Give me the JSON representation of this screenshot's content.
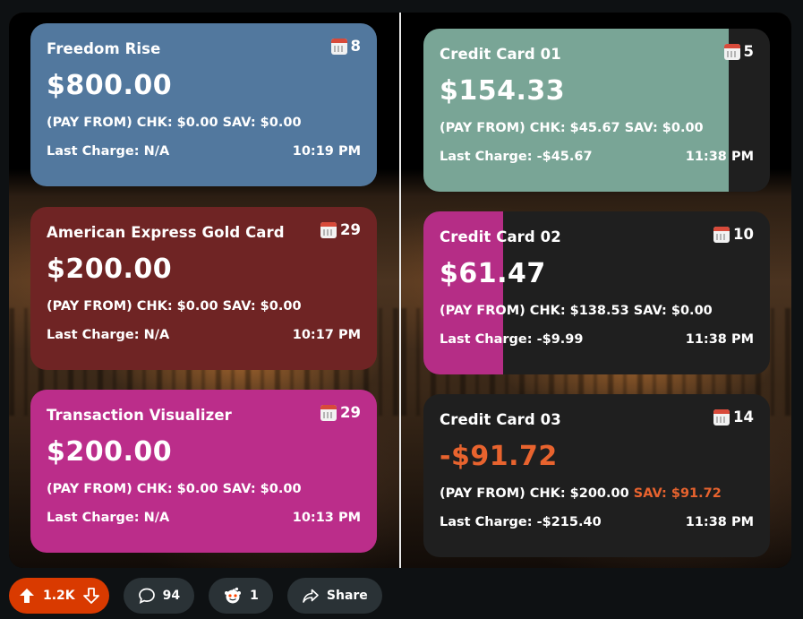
{
  "left_cards": [
    {
      "title": "Freedom Rise",
      "days": "8",
      "amount": "$800.00",
      "pay_from_prefix": "(PAY FROM) CHK: $0.00 SAV: $0.00",
      "last_charge": "Last Charge: N/A",
      "time": "10:19 PM",
      "color": "#52789e"
    },
    {
      "title": "American Express Gold Card",
      "days": "29",
      "amount": "$200.00",
      "pay_from_prefix": "(PAY FROM) CHK: $0.00 SAV: $0.00",
      "last_charge": "Last Charge: N/A",
      "time": "10:17 PM",
      "color": "#6f2424"
    },
    {
      "title": "Transaction Visualizer",
      "days": "29",
      "amount": "$200.00",
      "pay_from_prefix": "(PAY FROM) CHK: $0.00 SAV: $0.00",
      "last_charge": "Last Charge: N/A",
      "time": "10:13 PM",
      "color": "#bb2d8a"
    }
  ],
  "right_cards": [
    {
      "title": "Credit Card 01",
      "days": "5",
      "amount": "$154.33",
      "pay_from_chk": "(PAY FROM) CHK: $45.67",
      "pay_from_sav": "SAV: $0.00",
      "last_charge": "Last Charge: -$45.67",
      "time": "11:38 PM",
      "color": "#79a596",
      "progress": 0.88
    },
    {
      "title": "Credit Card 02",
      "days": "10",
      "amount": "$61.47",
      "pay_from_chk": "(PAY FROM) CHK: $138.53",
      "pay_from_sav": "SAV: $0.00",
      "last_charge": "Last Charge: -$9.99",
      "time": "11:38 PM",
      "color": "#b52d86",
      "progress": 0.23
    },
    {
      "title": "Credit Card 03",
      "days": "14",
      "amount": "-$91.72",
      "pay_from_chk": "(PAY FROM) CHK: $200.00",
      "pay_from_sav": "SAV: $91.72",
      "last_charge": "Last Charge: -$215.40",
      "time": "11:38 PM",
      "color": "#1f1f1f",
      "progress": 0
    }
  ],
  "actions": {
    "upvotes": "1.2K",
    "comments": "94",
    "awards": "1",
    "share_label": "Share"
  },
  "icons": {
    "calendar": "calendar-icon",
    "upvote": "upvote-arrow-icon",
    "downvote": "downvote-arrow-icon",
    "comment": "comment-bubble-icon",
    "award": "award-icon",
    "share": "share-arrow-icon"
  },
  "colors": {
    "negative": "#e8632e",
    "card_dark": "#1f1f1f",
    "vote_pill": "#d93a00",
    "pill": "#2a3236"
  }
}
